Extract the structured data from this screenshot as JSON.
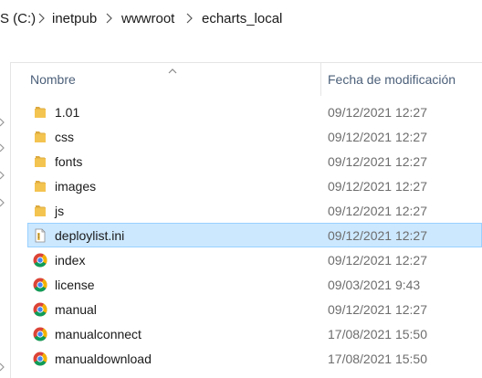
{
  "address": {
    "crumbs": [
      "S (C:)",
      "inetpub",
      "wwwroot",
      "echarts_local"
    ]
  },
  "columns": {
    "name": "Nombre",
    "date": "Fecha de modificación"
  },
  "colors": {
    "selection_bg": "#cce8ff",
    "selection_border": "#99d1ff",
    "folder": "#e8b84a",
    "header_text": "#4c607a"
  },
  "files": [
    {
      "name": "1.01",
      "date": "09/12/2021 12:27",
      "icon": "folder-icon"
    },
    {
      "name": "css",
      "date": "09/12/2021 12:27",
      "icon": "folder-icon"
    },
    {
      "name": "fonts",
      "date": "09/12/2021 12:27",
      "icon": "folder-icon"
    },
    {
      "name": "images",
      "date": "09/12/2021 12:27",
      "icon": "folder-icon"
    },
    {
      "name": "js",
      "date": "09/12/2021 12:27",
      "icon": "folder-icon"
    },
    {
      "name": "deploylist.ini",
      "date": "09/12/2021 12:27",
      "icon": "ini-file-icon",
      "selected": true
    },
    {
      "name": "index",
      "date": "09/12/2021 12:27",
      "icon": "chrome-html-icon"
    },
    {
      "name": "license",
      "date": "09/03/2021 9:43",
      "icon": "chrome-html-icon"
    },
    {
      "name": "manual",
      "date": "09/12/2021 12:27",
      "icon": "chrome-html-icon"
    },
    {
      "name": "manualconnect",
      "date": "17/08/2021 15:50",
      "icon": "chrome-html-icon"
    },
    {
      "name": "manualdownload",
      "date": "17/08/2021 15:50",
      "icon": "chrome-html-icon"
    }
  ]
}
